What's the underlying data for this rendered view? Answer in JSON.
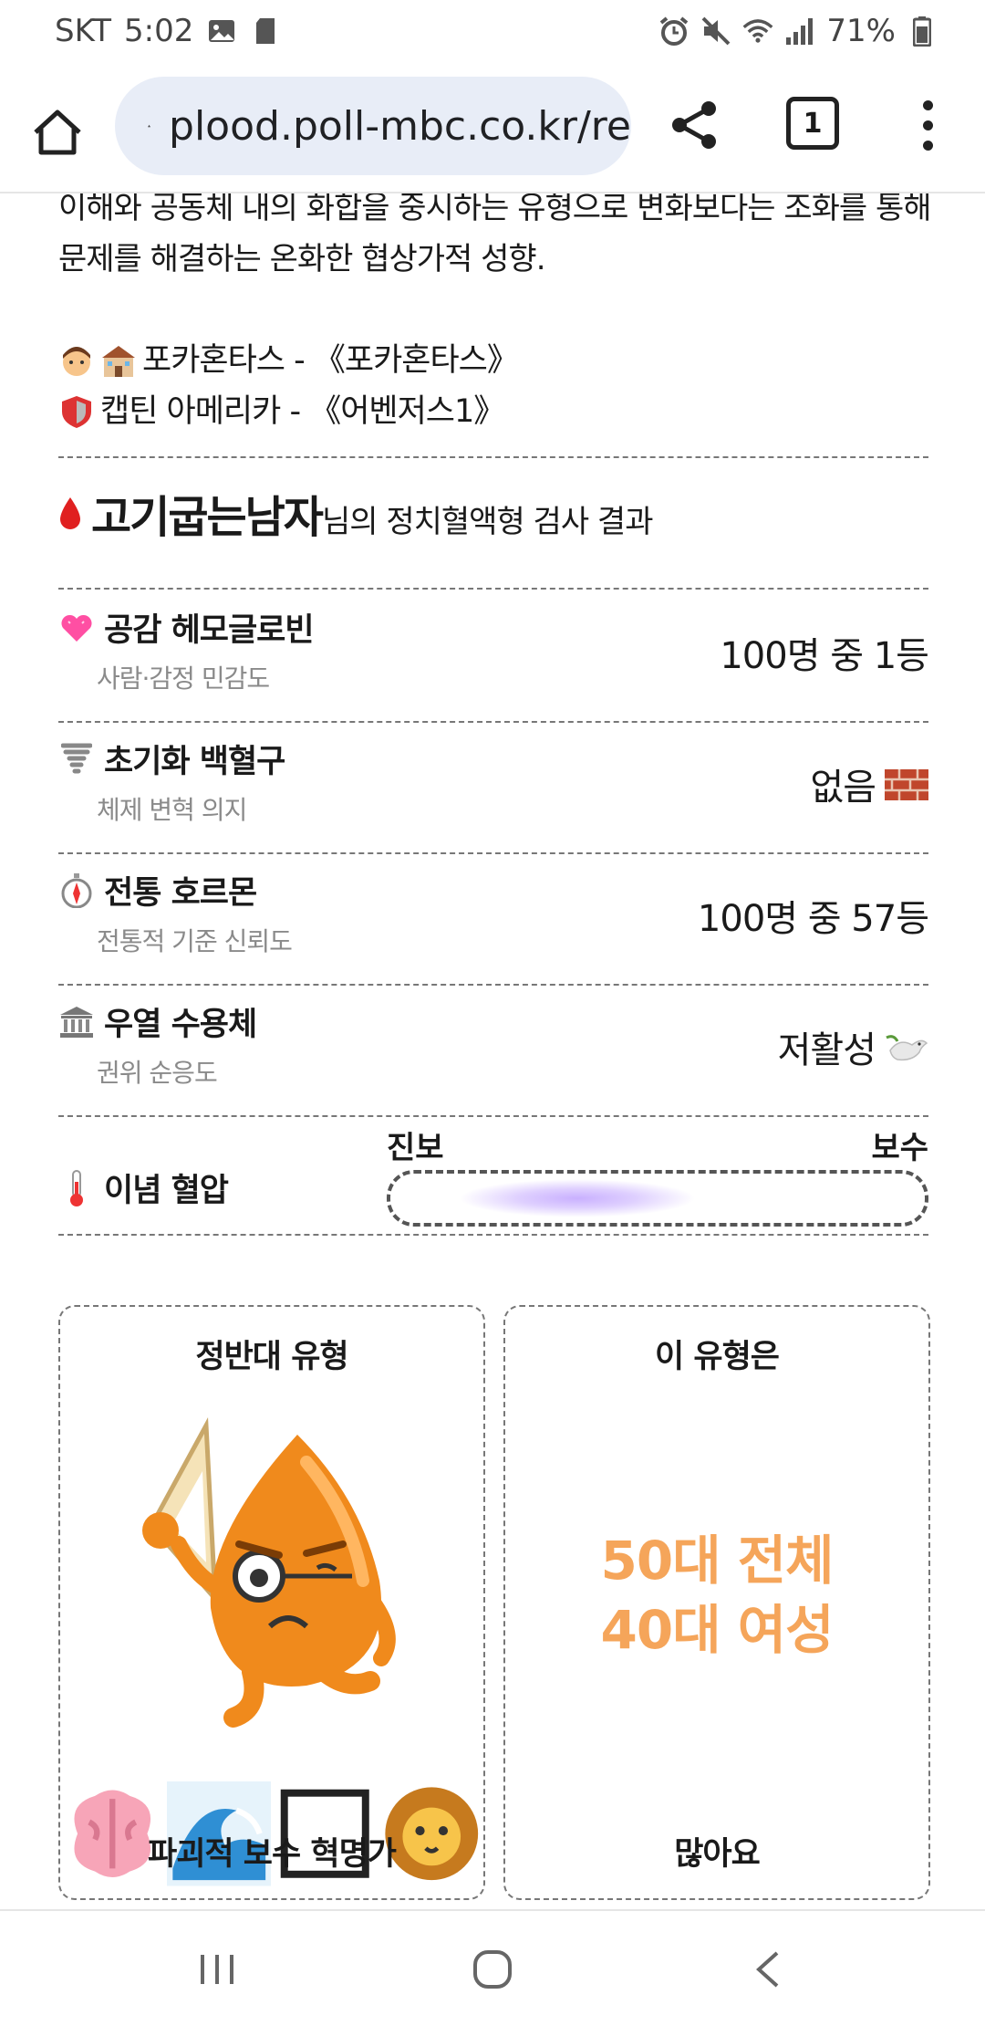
{
  "status_bar": {
    "carrier": "SKT",
    "time": "5:02",
    "battery": "71%"
  },
  "browser": {
    "url": "plood.poll-mbc.co.kr/re",
    "tab_count": "1"
  },
  "description": {
    "text": "이해와 공동체 내의 화합을 중시하는 유형으로 변화보다는 조화를 통해 문제를 해결하는 온화한 협상가적 성향."
  },
  "examples": [
    {
      "icons": [
        "boy-icon",
        "school-icon"
      ],
      "text": "포카혼타스 - 《포카혼타스》"
    },
    {
      "icons": [
        "shield-icon"
      ],
      "text": "캡틴 아메리카 - 《어벤저스1》"
    }
  ],
  "result": {
    "name": "고기굽는남자",
    "suffix": "님의 정치혈액형 검사 결과"
  },
  "metrics": [
    {
      "icon": "heart-icon",
      "label": "공감 헤모글로빈",
      "sub": "사람·감정 민감도",
      "value": "100명 중 1등"
    },
    {
      "icon": "tornado-icon",
      "label": "초기화 백혈구",
      "sub": "체제 변혁 의지",
      "value": "없음",
      "value_icon": "brick-icon"
    },
    {
      "icon": "compass-icon",
      "label": "전통 호르몬",
      "sub": "전통적 기준 신뢰도",
      "value": "100명 중 57등"
    },
    {
      "icon": "classical-building-icon",
      "label": "우열 수용체",
      "sub": "권위 순응도",
      "value": "저활성",
      "value_icon": "dove-icon"
    }
  ],
  "ideology": {
    "label": "이념 혈압",
    "left_label": "진보",
    "right_label": "보수",
    "marker_position": 0.35,
    "marker_color": "#c9b0ff"
  },
  "cards": {
    "opposite": {
      "title": "정반대 유형",
      "emojis": [
        "brain-icon",
        "wave-icon",
        "box-icon",
        "lion-icon"
      ],
      "type_name": "파괴적 보수 혁명가"
    },
    "demographic": {
      "title": "이 유형은",
      "line1": "50대 전체",
      "line2": "40대 여성",
      "footer": "많아요",
      "accent": "#f5a55a"
    }
  }
}
